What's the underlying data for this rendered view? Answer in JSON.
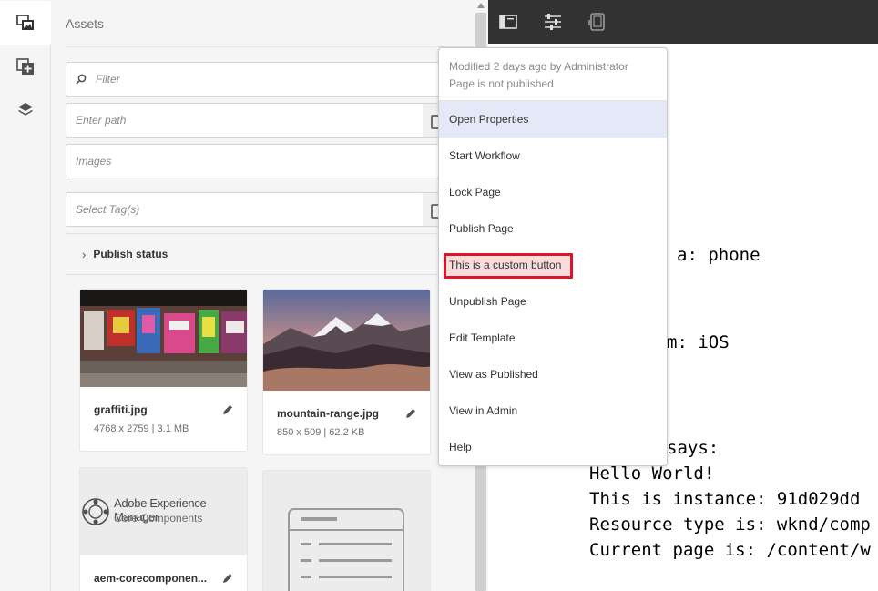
{
  "side_rail": {
    "items": [
      {
        "icon": "assets-icon",
        "active": true
      },
      {
        "icon": "components-icon",
        "active": false
      },
      {
        "icon": "content-tree-icon",
        "active": false
      }
    ]
  },
  "assets_panel": {
    "title": "Assets",
    "filter_placeholder": "Filter",
    "path_placeholder": "Enter path",
    "type_value": "Images",
    "tags_placeholder": "Select Tag(s)",
    "publish_status_label": "Publish status",
    "cards": [
      {
        "name": "graffiti.jpg",
        "meta": "4768 x 2759 | 3.1 MB"
      },
      {
        "name": "mountain-range.jpg",
        "meta": "850 x 509 | 62.2 KB"
      },
      {
        "name": "aem-corecomponen...",
        "logo_line1": "Adobe Experience Manager",
        "logo_line2": "Core Components"
      },
      {
        "name": ""
      }
    ]
  },
  "editor": {
    "toolbar_icons": [
      "side-panel-icon",
      "properties-icon",
      "emulator-icon"
    ],
    "canvas_lines": [
      "a: phone",
      "m: iOS",
      "says:",
      "Hello World!",
      "This is instance: 91d029dd",
      "Resource type is: wknd/comp",
      "Current page is: /content/w"
    ]
  },
  "page_info_menu": {
    "modified_text": "Modified 2 days ago by Administrator",
    "status_text": "Page is not published",
    "items": [
      "Open Properties",
      "Start Workflow",
      "Lock Page",
      "Publish Page",
      "This is a custom button",
      "Unpublish Page",
      "Edit Template",
      "View as Published",
      "View in Admin",
      "Help"
    ],
    "highlighted_item": "Open Properties",
    "emphasized_item": "This is a custom button",
    "emphasis_color": "#d7182a"
  },
  "colors": {
    "toolbar_bg": "#323232",
    "panel_bg": "#f5f5f5",
    "menu_highlight": "#e5e8f7"
  }
}
